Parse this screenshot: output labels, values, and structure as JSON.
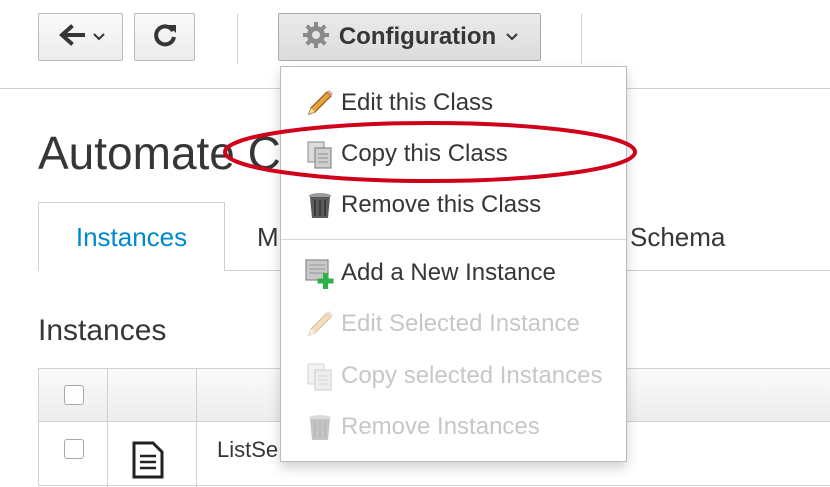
{
  "toolbar": {
    "back_icon": "arrow-left-icon",
    "reload_icon": "refresh-icon",
    "configuration_label": "Configuration",
    "configuration_icon": "gear-icon"
  },
  "page": {
    "title": "Automate C",
    "tabs": [
      {
        "label": "Instances",
        "active": true
      },
      {
        "label": "M"
      },
      {
        "label": "Schema"
      }
    ],
    "section_title": "Instances"
  },
  "table": {
    "rows": [
      {
        "icon": "document-icon",
        "name": "ListSe"
      }
    ]
  },
  "menu": {
    "items": [
      {
        "label": "Edit this Class",
        "icon": "pencil-icon",
        "enabled": true
      },
      {
        "label": "Copy this Class",
        "icon": "copy-icon",
        "enabled": true,
        "highlighted": true
      },
      {
        "label": "Remove this Class",
        "icon": "trash-icon",
        "enabled": true
      },
      {
        "label": "Add a New Instance",
        "icon": "add-instance-icon",
        "enabled": true
      },
      {
        "label": "Edit Selected Instance",
        "icon": "pencil-icon",
        "enabled": false
      },
      {
        "label": "Copy selected Instances",
        "icon": "copy-icon",
        "enabled": false
      },
      {
        "label": "Remove Instances",
        "icon": "trash-icon",
        "enabled": false
      }
    ]
  },
  "colors": {
    "accent": "#0088ce",
    "highlight_ring": "#d0021b",
    "disabled_text": "#c7c7c7"
  }
}
